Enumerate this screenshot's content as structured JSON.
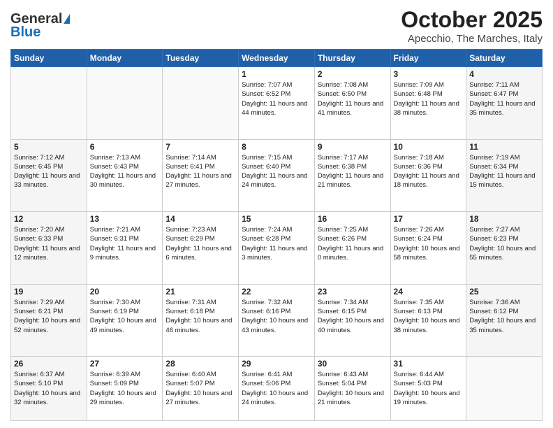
{
  "header": {
    "logo_general": "General",
    "logo_blue": "Blue",
    "month": "October 2025",
    "location": "Apecchio, The Marches, Italy"
  },
  "weekdays": [
    "Sunday",
    "Monday",
    "Tuesday",
    "Wednesday",
    "Thursday",
    "Friday",
    "Saturday"
  ],
  "weeks": [
    [
      {
        "day": "",
        "info": ""
      },
      {
        "day": "",
        "info": ""
      },
      {
        "day": "",
        "info": ""
      },
      {
        "day": "1",
        "info": "Sunrise: 7:07 AM\nSunset: 6:52 PM\nDaylight: 11 hours and 44 minutes."
      },
      {
        "day": "2",
        "info": "Sunrise: 7:08 AM\nSunset: 6:50 PM\nDaylight: 11 hours and 41 minutes."
      },
      {
        "day": "3",
        "info": "Sunrise: 7:09 AM\nSunset: 6:48 PM\nDaylight: 11 hours and 38 minutes."
      },
      {
        "day": "4",
        "info": "Sunrise: 7:11 AM\nSunset: 6:47 PM\nDaylight: 11 hours and 35 minutes."
      }
    ],
    [
      {
        "day": "5",
        "info": "Sunrise: 7:12 AM\nSunset: 6:45 PM\nDaylight: 11 hours and 33 minutes."
      },
      {
        "day": "6",
        "info": "Sunrise: 7:13 AM\nSunset: 6:43 PM\nDaylight: 11 hours and 30 minutes."
      },
      {
        "day": "7",
        "info": "Sunrise: 7:14 AM\nSunset: 6:41 PM\nDaylight: 11 hours and 27 minutes."
      },
      {
        "day": "8",
        "info": "Sunrise: 7:15 AM\nSunset: 6:40 PM\nDaylight: 11 hours and 24 minutes."
      },
      {
        "day": "9",
        "info": "Sunrise: 7:17 AM\nSunset: 6:38 PM\nDaylight: 11 hours and 21 minutes."
      },
      {
        "day": "10",
        "info": "Sunrise: 7:18 AM\nSunset: 6:36 PM\nDaylight: 11 hours and 18 minutes."
      },
      {
        "day": "11",
        "info": "Sunrise: 7:19 AM\nSunset: 6:34 PM\nDaylight: 11 hours and 15 minutes."
      }
    ],
    [
      {
        "day": "12",
        "info": "Sunrise: 7:20 AM\nSunset: 6:33 PM\nDaylight: 11 hours and 12 minutes."
      },
      {
        "day": "13",
        "info": "Sunrise: 7:21 AM\nSunset: 6:31 PM\nDaylight: 11 hours and 9 minutes."
      },
      {
        "day": "14",
        "info": "Sunrise: 7:23 AM\nSunset: 6:29 PM\nDaylight: 11 hours and 6 minutes."
      },
      {
        "day": "15",
        "info": "Sunrise: 7:24 AM\nSunset: 6:28 PM\nDaylight: 11 hours and 3 minutes."
      },
      {
        "day": "16",
        "info": "Sunrise: 7:25 AM\nSunset: 6:26 PM\nDaylight: 11 hours and 0 minutes."
      },
      {
        "day": "17",
        "info": "Sunrise: 7:26 AM\nSunset: 6:24 PM\nDaylight: 10 hours and 58 minutes."
      },
      {
        "day": "18",
        "info": "Sunrise: 7:27 AM\nSunset: 6:23 PM\nDaylight: 10 hours and 55 minutes."
      }
    ],
    [
      {
        "day": "19",
        "info": "Sunrise: 7:29 AM\nSunset: 6:21 PM\nDaylight: 10 hours and 52 minutes."
      },
      {
        "day": "20",
        "info": "Sunrise: 7:30 AM\nSunset: 6:19 PM\nDaylight: 10 hours and 49 minutes."
      },
      {
        "day": "21",
        "info": "Sunrise: 7:31 AM\nSunset: 6:18 PM\nDaylight: 10 hours and 46 minutes."
      },
      {
        "day": "22",
        "info": "Sunrise: 7:32 AM\nSunset: 6:16 PM\nDaylight: 10 hours and 43 minutes."
      },
      {
        "day": "23",
        "info": "Sunrise: 7:34 AM\nSunset: 6:15 PM\nDaylight: 10 hours and 40 minutes."
      },
      {
        "day": "24",
        "info": "Sunrise: 7:35 AM\nSunset: 6:13 PM\nDaylight: 10 hours and 38 minutes."
      },
      {
        "day": "25",
        "info": "Sunrise: 7:36 AM\nSunset: 6:12 PM\nDaylight: 10 hours and 35 minutes."
      }
    ],
    [
      {
        "day": "26",
        "info": "Sunrise: 6:37 AM\nSunset: 5:10 PM\nDaylight: 10 hours and 32 minutes."
      },
      {
        "day": "27",
        "info": "Sunrise: 6:39 AM\nSunset: 5:09 PM\nDaylight: 10 hours and 29 minutes."
      },
      {
        "day": "28",
        "info": "Sunrise: 6:40 AM\nSunset: 5:07 PM\nDaylight: 10 hours and 27 minutes."
      },
      {
        "day": "29",
        "info": "Sunrise: 6:41 AM\nSunset: 5:06 PM\nDaylight: 10 hours and 24 minutes."
      },
      {
        "day": "30",
        "info": "Sunrise: 6:43 AM\nSunset: 5:04 PM\nDaylight: 10 hours and 21 minutes."
      },
      {
        "day": "31",
        "info": "Sunrise: 6:44 AM\nSunset: 5:03 PM\nDaylight: 10 hours and 19 minutes."
      },
      {
        "day": "",
        "info": ""
      }
    ]
  ]
}
